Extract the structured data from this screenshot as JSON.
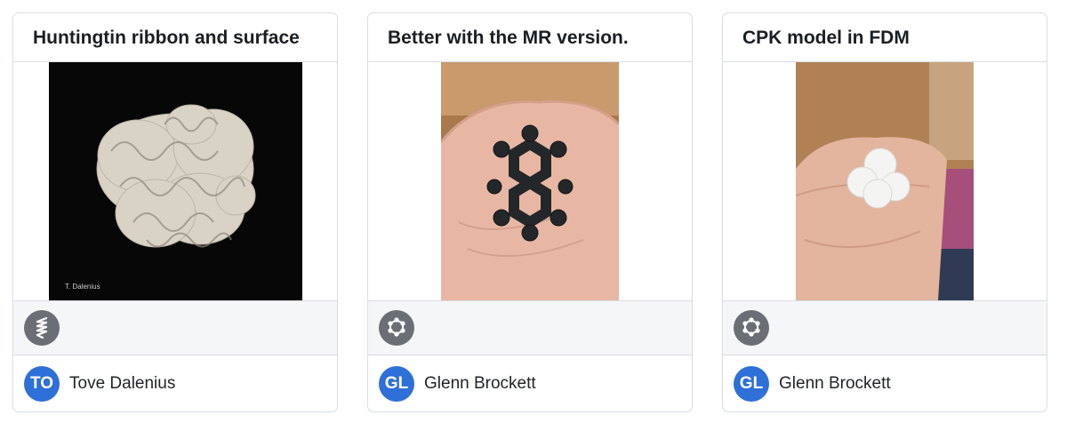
{
  "cards": [
    {
      "title": "Huntingtin ribbon and surface",
      "image_name": "huntingtin-ribbon-model-photo",
      "image_caption": "T. Dalenius",
      "tool_icon": "helix-icon",
      "author_initials": "TO",
      "author_name": "Tove Dalenius"
    },
    {
      "title": "Better with the MR version.",
      "image_name": "black-ring-molecule-in-hand-photo",
      "tool_icon": "molecule-icon",
      "author_initials": "GL",
      "author_name": "Glenn Brockett"
    },
    {
      "title": "CPK model in FDM",
      "image_name": "white-cpk-model-in-hand-photo",
      "tool_icon": "molecule-icon",
      "author_initials": "GL",
      "author_name": "Glenn Brockett"
    }
  ],
  "colors": {
    "avatar": "#2e6fd8",
    "tool_icon_bg": "#6b6f75",
    "border": "#d9dde2",
    "tools_bg": "#f5f6f8"
  }
}
